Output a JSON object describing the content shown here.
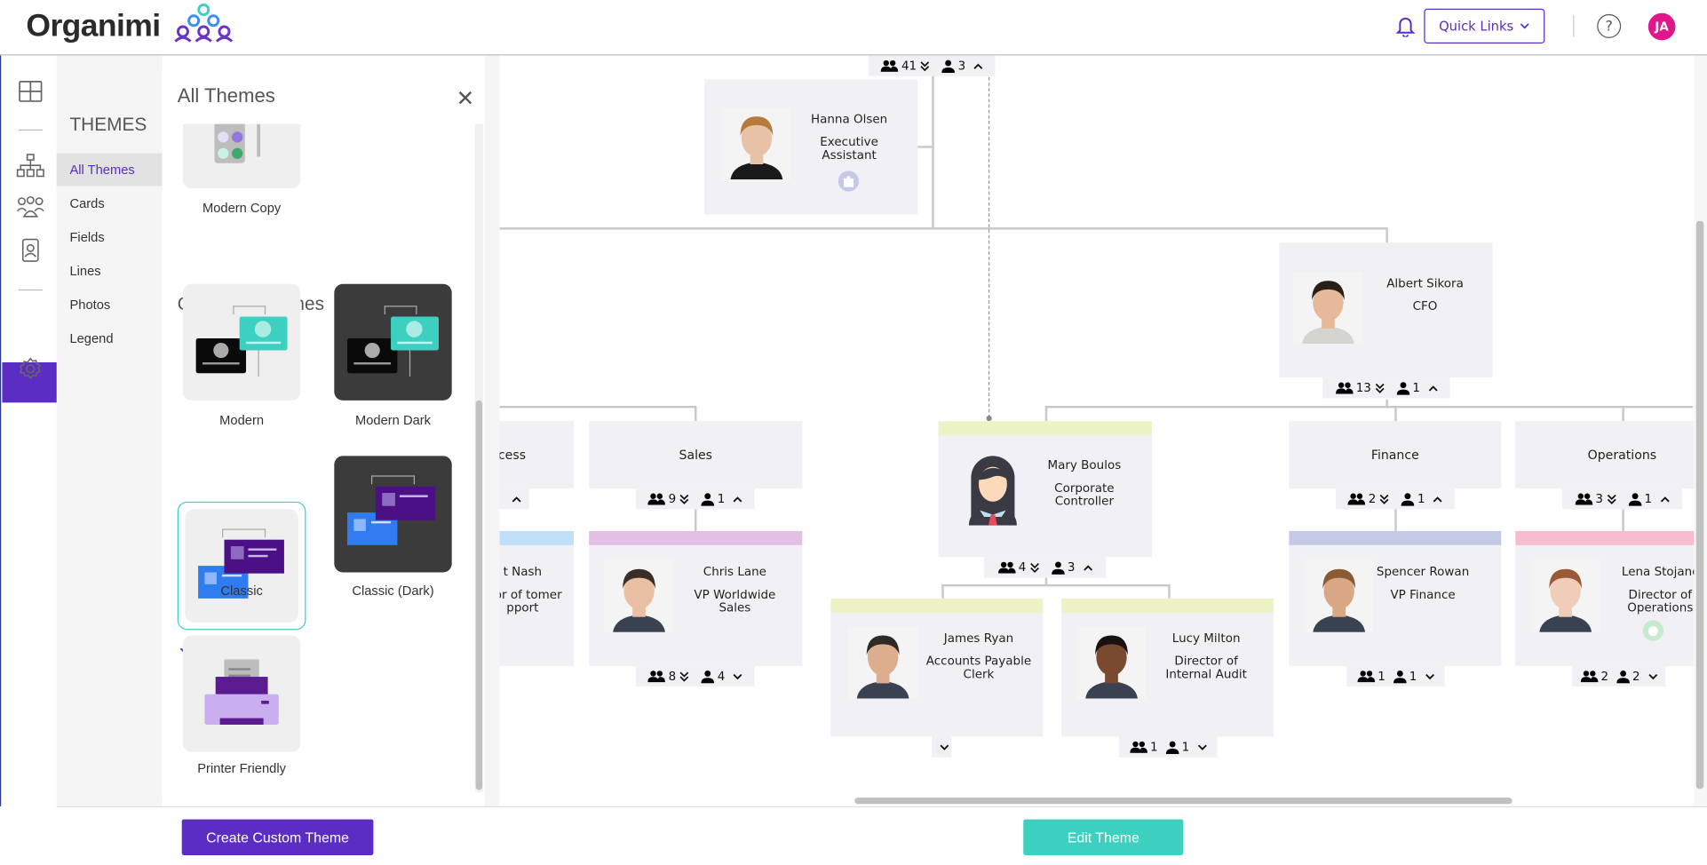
{
  "header": {
    "logo": "Organimi",
    "quick_links": "Quick Links",
    "help": "?",
    "avatar_initials": "JA",
    "colors": {
      "brand": "#5b2dc2",
      "accent": "#3dd0c0",
      "avatar": "#e0168a"
    }
  },
  "rail": {
    "icons": [
      "grid-icon",
      "org-chart-icon",
      "people-icon",
      "directory-icon",
      "palette-icon",
      "gear-icon"
    ],
    "active": "palette-icon"
  },
  "nav": {
    "title": "THEMES",
    "items": [
      {
        "label": "All Themes",
        "active": true
      },
      {
        "label": "Cards"
      },
      {
        "label": "Fields"
      },
      {
        "label": "Lines"
      },
      {
        "label": "Photos"
      },
      {
        "label": "Legend"
      }
    ]
  },
  "panel": {
    "title": "All Themes",
    "custom_themes": [
      {
        "label": "Modern Copy"
      }
    ],
    "section_title": "Organimi Themes",
    "themes": [
      {
        "label": "Modern"
      },
      {
        "label": "Modern Dark"
      },
      {
        "label": "Classic",
        "selected": true
      },
      {
        "label": "Classic (Dark)"
      },
      {
        "label": "Printer Friendly"
      }
    ]
  },
  "footer": {
    "create_button": "Create Custom Theme",
    "edit_button": "Edit Theme"
  },
  "chart": {
    "root_counter": {
      "team": "41",
      "team_arrow": "double-down",
      "reports": "3",
      "reports_arrow": "up"
    },
    "nodes": [
      {
        "id": "hanna",
        "name": "Hanna Olsen",
        "title": "Executive Assistant",
        "badge": "building-icon"
      },
      {
        "id": "albert",
        "name": "Albert Sikora",
        "title": "CFO",
        "counter": {
          "team": "13",
          "team_arrow": "double-down",
          "reports": "1",
          "reports_arrow": "up"
        }
      },
      {
        "id": "cess",
        "department": "cess",
        "counter": {
          "team": "",
          "team_arrow": "",
          "reports": "",
          "reports_arrow": "up"
        }
      },
      {
        "id": "sales",
        "department": "Sales",
        "counter": {
          "team": "9",
          "team_arrow": "double-down",
          "reports": "1",
          "reports_arrow": "up"
        }
      },
      {
        "id": "mary",
        "name": "Mary Boulos",
        "title": "Corporate Controller",
        "color": "#eef3c6",
        "counter": {
          "team": "4",
          "team_arrow": "double-down",
          "reports": "3",
          "reports_arrow": "up"
        }
      },
      {
        "id": "finance",
        "department": "Finance",
        "counter": {
          "team": "2",
          "team_arrow": "double-down",
          "reports": "1",
          "reports_arrow": "up"
        }
      },
      {
        "id": "operations",
        "department": "Operations",
        "counter": {
          "team": "3",
          "team_arrow": "double-down",
          "reports": "1",
          "reports_arrow": "up"
        }
      },
      {
        "id": "nash",
        "name": "t Nash",
        "title": "ctor of tomer pport",
        "color": "#bfe0f8"
      },
      {
        "id": "chris",
        "name": "Chris Lane",
        "title": "VP Worldwide Sales",
        "color": "#e2c0e4",
        "counter": {
          "team": "8",
          "team_arrow": "double-down",
          "reports": "4",
          "reports_arrow": "down"
        }
      },
      {
        "id": "spencer",
        "name": "Spencer Rowan",
        "title": "VP Finance",
        "color": "#c4c9e6",
        "counter": {
          "team": "1",
          "team_arrow": "",
          "reports": "1",
          "reports_arrow": "down"
        }
      },
      {
        "id": "lena",
        "name": "Lena Stojanc",
        "title": "Director of Operations",
        "color": "#f7bcd0",
        "badge": "face-icon",
        "counter": {
          "team": "2",
          "team_arrow": "",
          "reports": "2",
          "reports_arrow": "down"
        }
      },
      {
        "id": "james",
        "name": "James Ryan",
        "title": "Accounts Payable Clerk",
        "color": "#eef3c6",
        "counter": {
          "team": "",
          "team_arrow": "",
          "reports": "",
          "reports_arrow": "down"
        }
      },
      {
        "id": "lucy",
        "name": "Lucy Milton",
        "title": "Director of Internal Audit",
        "color": "#eef3c6",
        "counter": {
          "team": "1",
          "team_arrow": "",
          "reports": "1",
          "reports_arrow": "down"
        }
      }
    ]
  }
}
